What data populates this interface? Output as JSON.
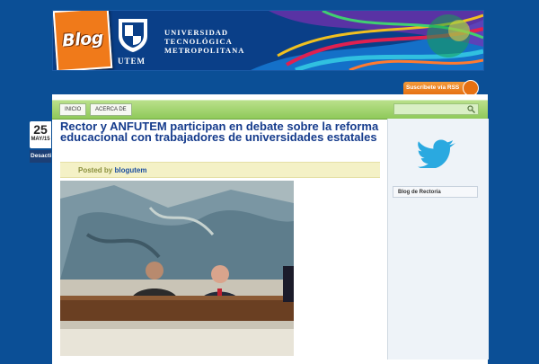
{
  "header": {
    "blog_badge": "Blog",
    "logo_short": "UTEM",
    "university_lines": [
      "UNIVERSIDAD",
      "TECNOLÓGICA",
      "METROPOLITANA"
    ]
  },
  "nav": {
    "items": [
      {
        "label": "INICIO"
      },
      {
        "label": "ACERCA DE"
      }
    ],
    "search_placeholder": "",
    "rss_label": "Suscríbete vía RSS"
  },
  "post": {
    "date_day": "25",
    "date_month": "MAY/15",
    "category": "Desactivar",
    "title": "Rector y ANFUTEM participan en debate sobre la reforma educacional con trabajadores de universidades estatales",
    "posted_by_label": "Posted by",
    "author": "blogutem"
  },
  "sidebar": {
    "widget_title": "Blog de Rectoría"
  },
  "colors": {
    "page_bg": "#0b4f96",
    "nav_green": "#8fc95a",
    "title_blue": "#153b8c",
    "rss_orange": "#e67012"
  }
}
